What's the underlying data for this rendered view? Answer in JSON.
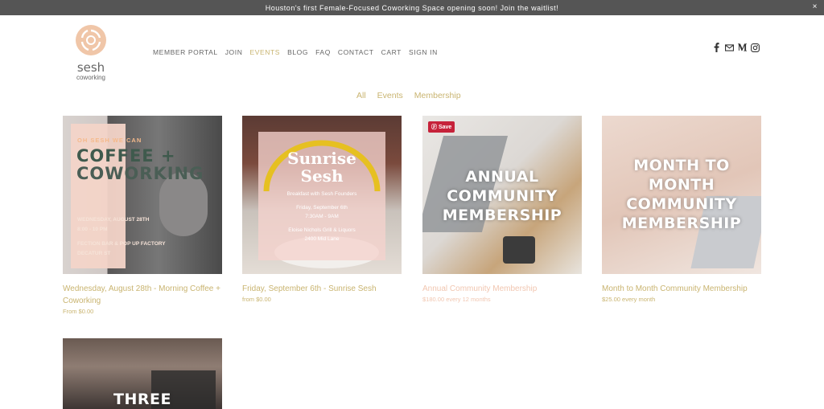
{
  "banner": {
    "text": "Houston's first Female-Focused Coworking Space opening soon! Join the waitlist!",
    "close": "×"
  },
  "logo": {
    "word1": "sesh",
    "word2": "coworking"
  },
  "nav": [
    {
      "label": "MEMBER PORTAL",
      "active": false
    },
    {
      "label": "JOIN",
      "active": false
    },
    {
      "label": "EVENTS",
      "active": true
    },
    {
      "label": "BLOG",
      "active": false
    },
    {
      "label": "FAQ",
      "active": false
    },
    {
      "label": "CONTACT",
      "active": false
    },
    {
      "label": "CART",
      "active": false
    },
    {
      "label": "SIGN IN",
      "active": false
    }
  ],
  "social": {
    "icons": [
      "facebook-icon",
      "email-icon",
      "medium-icon",
      "instagram-icon"
    ]
  },
  "filters": [
    "All",
    "Events",
    "Membership"
  ],
  "colors": {
    "accent": "#c9b470",
    "muted": "#f1c6b0",
    "banner": "#555555",
    "save": "#c6223a"
  },
  "products": [
    {
      "title": "Wednesday, August 28th - Morning Coffee + Coworking",
      "price": "From $0.00",
      "image": {
        "tag": "OH SESH WE CAN",
        "headline1": "COFFEE +",
        "headline2": "COWORKING",
        "line1": "WEDNESDAY, AUGUST 28TH",
        "line2": "8:00 - 10 PM",
        "line3": "FECTION BAR & POP UP FACTORY",
        "line4": "DECATUR ST"
      }
    },
    {
      "title": "Friday, September 6th - Sunrise Sesh",
      "price": "from $0.00",
      "image": {
        "headline1": "Sunrise",
        "headline2": "Sesh",
        "sub": "Breakfast with Sesh Founders",
        "date": "Friday, September 6th",
        "time": "7:30AM - 9AM",
        "venue": "Eloise Nichols Grill & Liquors",
        "address": "2400 Mid Lane"
      }
    },
    {
      "title": "Annual Community Membership",
      "price": "$180.00 every 12 months",
      "save": "Save",
      "image": {
        "headline1": "ANNUAL",
        "headline2": "COMMUNITY",
        "headline3": "MEMBERSHIP"
      }
    },
    {
      "title": "Month to Month Community Membership",
      "price": "$25.00 every month",
      "image": {
        "headline1": "MONTH TO",
        "headline2": "MONTH",
        "headline3": "COMMUNITY",
        "headline4": "MEMBERSHIP"
      }
    },
    {
      "title": "",
      "price": "",
      "image": {
        "headline1": "THREE"
      }
    }
  ]
}
